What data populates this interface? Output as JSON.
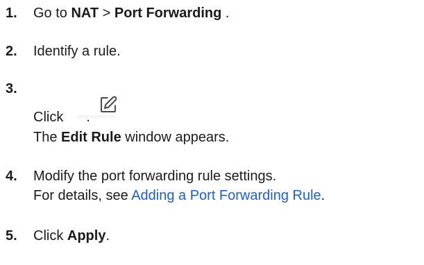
{
  "steps": [
    {
      "number": "1.",
      "text_1": "Go to ",
      "bold_1": "NAT",
      "sep": " > ",
      "bold_2": "Port Forwarding",
      "end": " ."
    },
    {
      "number": "2.",
      "text": "Identify a rule."
    },
    {
      "number": "3.",
      "text_1": "Click",
      "end": ".",
      "line2_prefix": "The ",
      "line2_bold": "Edit Rule",
      "line2_suffix": " window appears.",
      "icon": "edit-pencil-icon"
    },
    {
      "number": "4.",
      "text": "Modify the port forwarding rule settings.",
      "line2_prefix": "For details, see ",
      "link": "Adding a Port Forwarding Rule",
      "line2_suffix": "."
    },
    {
      "number": "5.",
      "text_1": "Click ",
      "bold": "Apply",
      "end": "."
    }
  ],
  "colors": {
    "text": "#1a1a1a",
    "link": "#1a5fd6",
    "icon": "#4a4a4a"
  }
}
